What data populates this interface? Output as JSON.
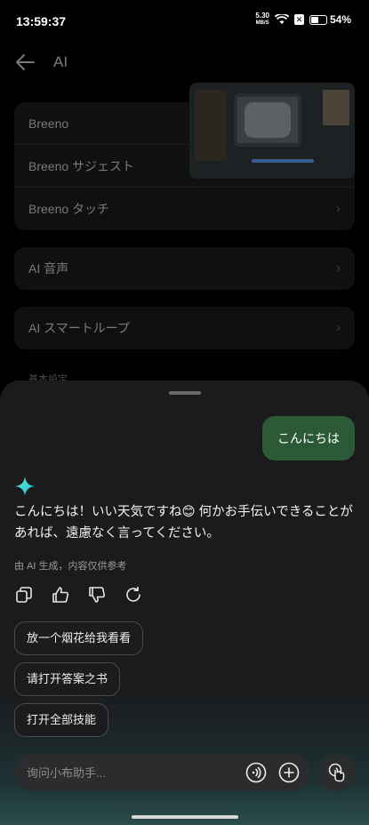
{
  "status_bar": {
    "time": "13:59:37",
    "net_speed_value": "5.30",
    "net_speed_unit": "MB/S",
    "battery": "54%",
    "sim_icon": "sim-off-icon",
    "wifi_icon": "wifi-icon"
  },
  "background_page": {
    "title": "AI",
    "group1": [
      "Breeno",
      "Breeno サジェスト",
      "Breeno タッチ"
    ],
    "group2": [
      "AI 音声"
    ],
    "group3": [
      "AI スマートループ"
    ],
    "section_hint": "基本設定"
  },
  "chat": {
    "user_message": "こんにちは",
    "ai_reply": "こんにちは！いい天気ですね😊 何かお手伝いできることがあれば、遠慮なく言ってください。",
    "disclaimer": "由 AI 生成，内容仅供参考",
    "suggestions": [
      "放一个烟花给我看看",
      "请打开答案之书",
      "打开全部技能"
    ]
  },
  "input": {
    "placeholder": "询问小布助手..."
  },
  "colors": {
    "user_bubble": "#2c5a36",
    "sheet_bg": "#1b1b1d",
    "accent_star": "#3fe0c0"
  }
}
